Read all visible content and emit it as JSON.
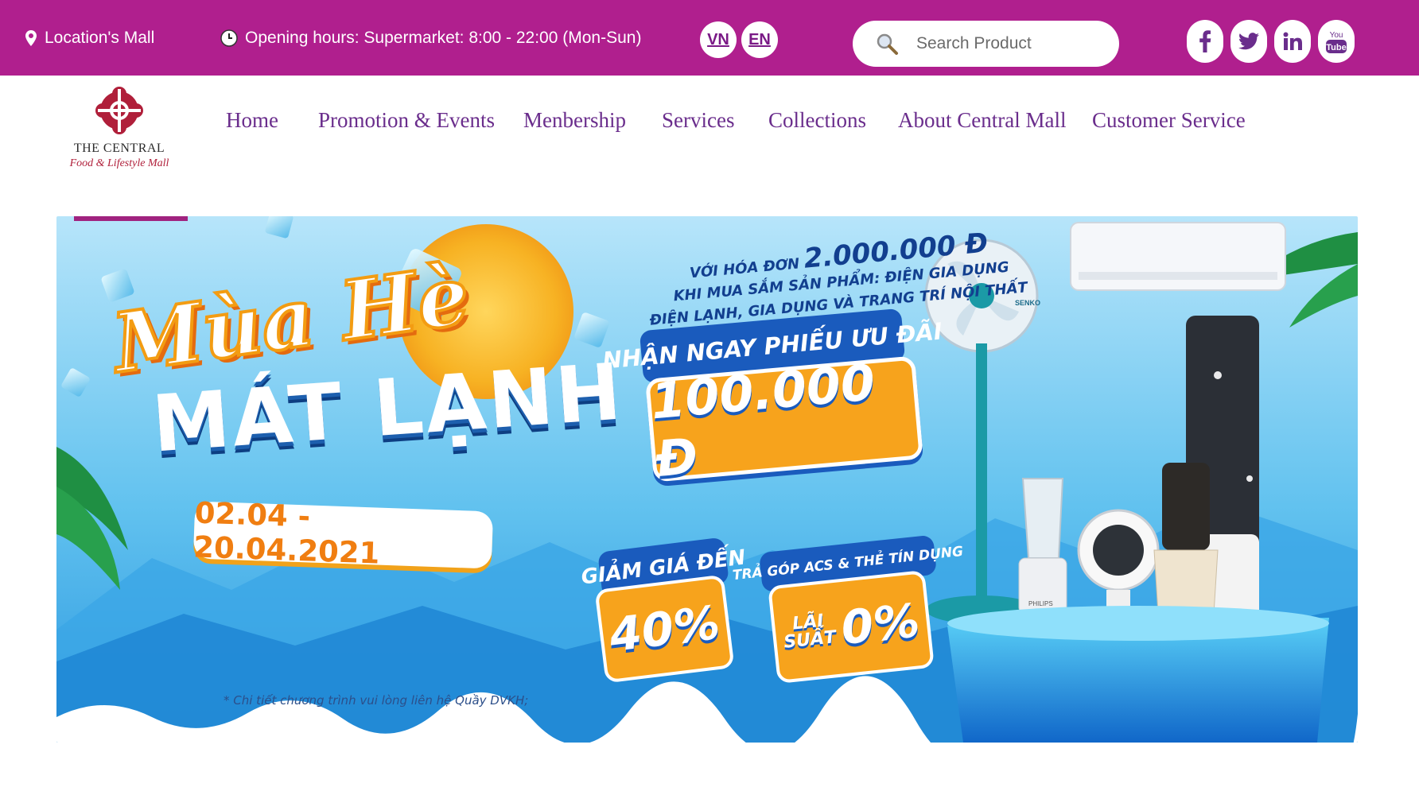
{
  "topbar": {
    "location": "Location's Mall",
    "opening_hours": "Opening hours: Supermarket: 8:00 - 22:00 (Mon-Sun)",
    "lang_vn": "VN",
    "lang_en": "EN",
    "search_placeholder": "Search Product",
    "social": [
      "facebook-icon",
      "twitter-icon",
      "linkedin-icon",
      "youtube-icon"
    ],
    "youtube_text_top": "You",
    "youtube_text_bottom": "Tube"
  },
  "logo": {
    "title": "THE CENTRAL",
    "subtitle": "Food & Lifestyle Mall"
  },
  "nav": {
    "items": [
      "Home",
      "Promotion & Events",
      "Menbership",
      "Services",
      "Collections",
      "About Central Mall",
      "Customer Service"
    ]
  },
  "banner": {
    "headline_top": "Mùa Hè",
    "headline_bottom": "MÁT LẠNH",
    "dates": "02.04 - 20.04.2021",
    "condition_1_prefix": "VỚI HÓA ĐƠN",
    "condition_1_amount": "2.000.000 Đ",
    "condition_2": "KHI MUA SẮM SẢN PHẨM: ĐIỆN GIA DỤNG",
    "condition_3": "ĐIỆN LẠNH, GIA DỤNG VÀ TRANG TRÍ NỘI THẤT",
    "voucher_label": "NHẬN NGAY PHIẾU ƯU ĐÃI",
    "voucher_amount": "100.000 Đ",
    "discount_label": "GIẢM GIÁ ĐẾN",
    "discount_value": "40%",
    "installment_label": "TRẢ GÓP ACS & THẺ TÍN DỤNG",
    "installment_word_1": "LÃI",
    "installment_word_2": "SUẤT",
    "installment_value": "0%",
    "footnote": "* Chi tiết chương trình vui lòng liên hệ Quầy DVKH;",
    "fan_brand": "SENKO",
    "blender_brand": "PHILIPS"
  },
  "colors": {
    "topbar": "#b01f8e",
    "nav_text": "#6a2d8c",
    "logo_red": "#b01f3a",
    "banner_orange": "#f7a31c",
    "banner_blue": "#1a5bbd"
  }
}
